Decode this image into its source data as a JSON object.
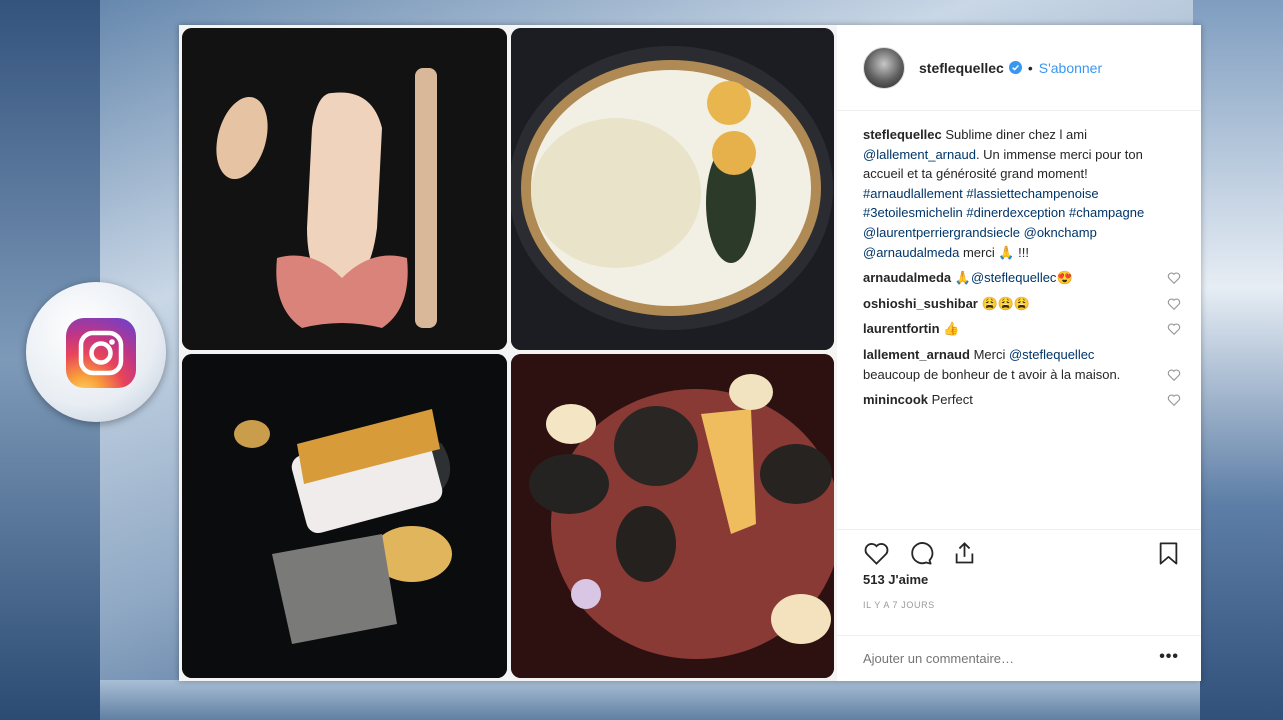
{
  "post": {
    "username": "steflequellec",
    "follow_label": "S'abonner",
    "caption_parts": {
      "user": "steflequellec",
      "t1": " Sublime diner chez l ami ",
      "m1": "@lallement_arnaud",
      "t2": ". Un immense merci pour ton accueil et ta générosité grand moment! ",
      "h1": "#arnaudlallement",
      "h2": "#lassiettechampenoise",
      "h3": "#3etoilesmichelin",
      "h4": "#dinerdexception",
      "h5": "#champagne",
      "m2": "@laurentperriergrandsiecle",
      "m3": "@oknchamp",
      "m4": "@arnaudalmeda",
      "t3": " merci 🙏 !!!"
    },
    "comments": [
      {
        "user": "arnaudalmeda",
        "pre": "🙏",
        "mention": "@steflequellec",
        "post": "😍"
      },
      {
        "user": "oshioshi_sushibar",
        "pre": "",
        "mention": "",
        "post": "😩😩😩"
      },
      {
        "user": "laurentfortin",
        "pre": "",
        "mention": "",
        "post": "👍"
      },
      {
        "user": "lallement_arnaud",
        "pre": "Merci",
        "mention": "@steflequellec",
        "post": "beaucoup de bonheur de t avoir à la maison."
      },
      {
        "user": "minincook",
        "pre": "Perfect",
        "mention": "",
        "post": ""
      }
    ],
    "likes": "513 J'aime",
    "time": "IL Y A 7 JOURS",
    "add_comment_placeholder": "Ajouter un commentaire…",
    "more_label": "•••"
  },
  "icons": {
    "badge": "instagram-icon",
    "verified": "verified-badge-icon",
    "like": "heart-icon",
    "comment": "comment-icon",
    "share": "share-icon",
    "save": "bookmark-icon"
  },
  "colors": {
    "link": "#003569",
    "follow": "#3897f0",
    "verified": "#3897f0"
  }
}
